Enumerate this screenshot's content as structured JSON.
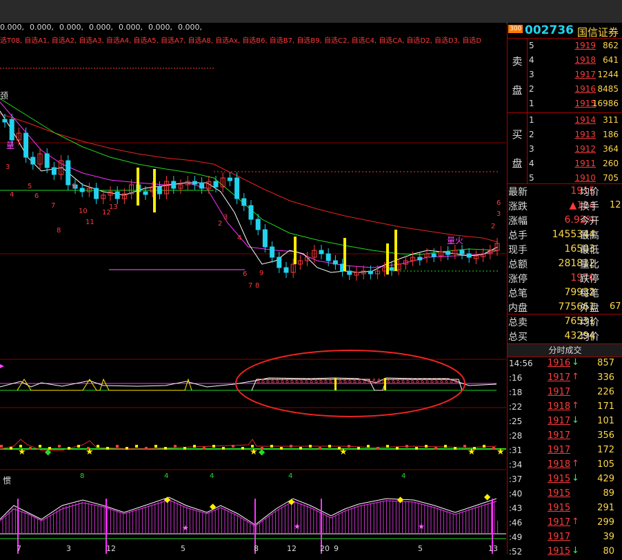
{
  "indicator_params": [
    "0.000,",
    "0.000,",
    "0.000,",
    "0.000,",
    "0.000,",
    "0.000,",
    "0.000,"
  ],
  "picklist": "选T08, 自选A1, 自选A2, 自选A3, 自选A4, 自选A5, 自选A7, 自选A8, 自选Ax, 自选B6, 自选B7, 自选B9, 自选C2, 自选C4, 自选CA, 自选D2, 自选D3, 自选D",
  "chart_labels": {
    "top_left": "颈",
    "pivot": "量",
    "fire": "量火",
    "panel4_title": "惯"
  },
  "stock": {
    "badge": "300",
    "code": "002736",
    "name": "国信证券"
  },
  "sell_label": [
    "卖",
    "盘"
  ],
  "buy_label": [
    "买",
    "盘"
  ],
  "sell": [
    {
      "level": "5",
      "price": "1919",
      "vol": "862"
    },
    {
      "level": "4",
      "price": "1918",
      "vol": "641"
    },
    {
      "level": "3",
      "price": "1917",
      "vol": "1244"
    },
    {
      "level": "2",
      "price": "1916",
      "vol": "8485"
    },
    {
      "level": "1",
      "price": "1915",
      "vol": "16986"
    }
  ],
  "buy": [
    {
      "level": "1",
      "price": "1914",
      "vol": "311"
    },
    {
      "level": "2",
      "price": "1913",
      "vol": "186"
    },
    {
      "level": "3",
      "price": "1912",
      "vol": "364"
    },
    {
      "level": "4",
      "price": "1911",
      "vol": "260"
    },
    {
      "level": "5",
      "price": "1910",
      "vol": "705"
    }
  ],
  "stats": [
    {
      "k": "最新",
      "v": "1915",
      "vc": "#ff3b3b",
      "k2": "均价",
      "v2": ""
    },
    {
      "k": "涨跌",
      "v": "▲124",
      "vc": "#ff3b3b",
      "k2": "换手",
      "v2": "12"
    },
    {
      "k": "涨幅",
      "v": "6.92%",
      "vc": "#ff3b3b",
      "k2": "今开",
      "v2": ""
    },
    {
      "k": "总手",
      "v": "1455344",
      "vc": "#ffd84a",
      "k2": "最高",
      "v2": ""
    },
    {
      "k": "现手",
      "v": "16503",
      "vc": "#ffd84a",
      "k2": "最低",
      "v2": ""
    },
    {
      "k": "总额",
      "v": "281812",
      "vc": "#ffd84a",
      "k2": "量比",
      "v2": ""
    },
    {
      "k": "涨停",
      "v": "1970",
      "vc": "#ff3b3b",
      "k2": "跌停",
      "v2": ""
    },
    {
      "k": "总笔",
      "v": "79932",
      "vc": "#ffd84a",
      "k2": "每笔",
      "v2": ""
    },
    {
      "k": "内盘",
      "v": "775661",
      "vc": "#ffd84a",
      "k2": "外盘",
      "v2": "67"
    },
    {
      "k": "总卖",
      "v": "76531",
      "vc": "#ffd84a",
      "k2": "均价",
      "v2": ""
    },
    {
      "k": "总买",
      "v": "43294",
      "vc": "#ffd84a",
      "k2": "均价",
      "v2": ""
    }
  ],
  "ticks_title": "分时成交",
  "ticks": [
    {
      "t": "14:56",
      "p": "1916",
      "a": "↓",
      "ac": "#22ff44",
      "q": "857"
    },
    {
      "t": ":16",
      "p": "1917",
      "a": "↑",
      "ac": "#ff3b3b",
      "q": "336"
    },
    {
      "t": ":18",
      "p": "1917",
      "a": "",
      "ac": "#ff3b3b",
      "q": "226"
    },
    {
      "t": ":22",
      "p": "1918",
      "a": "↑",
      "ac": "#ff3b3b",
      "q": "171"
    },
    {
      "t": ":25",
      "p": "1917",
      "a": "↓",
      "ac": "#22ff44",
      "q": "101"
    },
    {
      "t": ":28",
      "p": "1917",
      "a": "",
      "ac": "#ff3b3b",
      "q": "356"
    },
    {
      "t": ":31",
      "p": "1917",
      "a": "",
      "ac": "#ff3b3b",
      "q": "172"
    },
    {
      "t": ":34",
      "p": "1918",
      "a": "↑",
      "ac": "#ff3b3b",
      "q": "105"
    },
    {
      "t": ":37",
      "p": "1915",
      "a": "↓",
      "ac": "#22ff44",
      "q": "429"
    },
    {
      "t": ":40",
      "p": "1915",
      "a": "",
      "ac": "#ff3b3b",
      "q": "89"
    },
    {
      "t": ":43",
      "p": "1915",
      "a": "",
      "ac": "#ff3b3b",
      "q": "291"
    },
    {
      "t": ":46",
      "p": "1917",
      "a": "↑",
      "ac": "#ff3b3b",
      "q": "299"
    },
    {
      "t": ":49",
      "p": "1917",
      "a": "",
      "ac": "#ff3b3b",
      "q": "39"
    },
    {
      "t": ":52",
      "p": "1915",
      "a": "↓",
      "ac": "#22ff44",
      "q": "80"
    }
  ],
  "bottom_counts": [
    "7",
    "3",
    "12",
    "5",
    "8",
    "12",
    "20",
    "9",
    "5",
    "13"
  ],
  "panel4_counts": [
    "8",
    "4",
    "4",
    "4",
    "4"
  ],
  "colors": {
    "up": "#ff3b3b",
    "down": "#22d3ee",
    "highlight": "#ffee00",
    "ma_white": "#ffffff",
    "ma_magenta": "#ff33ff",
    "ma_green": "#22dd22",
    "ma_red": "#ee2222"
  }
}
